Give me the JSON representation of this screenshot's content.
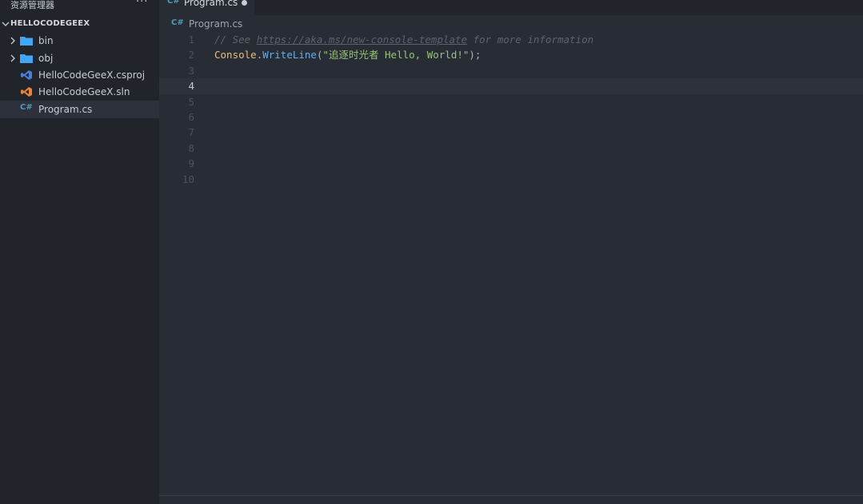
{
  "sidebar": {
    "title": "资源管理器",
    "more": "···",
    "folder": "HELLOCODEGEEX",
    "items": [
      {
        "label": "bin",
        "type": "folder"
      },
      {
        "label": "obj",
        "type": "folder"
      },
      {
        "label": "HelloCodeGeeX.csproj",
        "type": "csproj"
      },
      {
        "label": "HelloCodeGeeX.sln",
        "type": "sln"
      },
      {
        "label": "Program.cs",
        "type": "csharp",
        "selected": true
      }
    ]
  },
  "tab": {
    "icon_text": "C#",
    "label": "Program.cs",
    "modified": true
  },
  "breadcrumb": {
    "icon_text": "C#",
    "label": "Program.cs"
  },
  "code": {
    "line_numbers": [
      "1",
      "2",
      "3",
      "4",
      "5",
      "6",
      "7",
      "8",
      "9",
      "10"
    ],
    "current_line": 4,
    "line1": {
      "prefix": "// See ",
      "link": "https://aka.ms/new-console-template",
      "suffix": " for more information"
    },
    "line2": {
      "class": "Console",
      "dot": ".",
      "method": "WriteLine",
      "open": "(",
      "string": "\"追逐时光者 Hello, World!\"",
      "close": ");"
    }
  },
  "colors": {
    "accent": "#519aba",
    "background": "#282c34",
    "sidebar": "#21252b"
  }
}
